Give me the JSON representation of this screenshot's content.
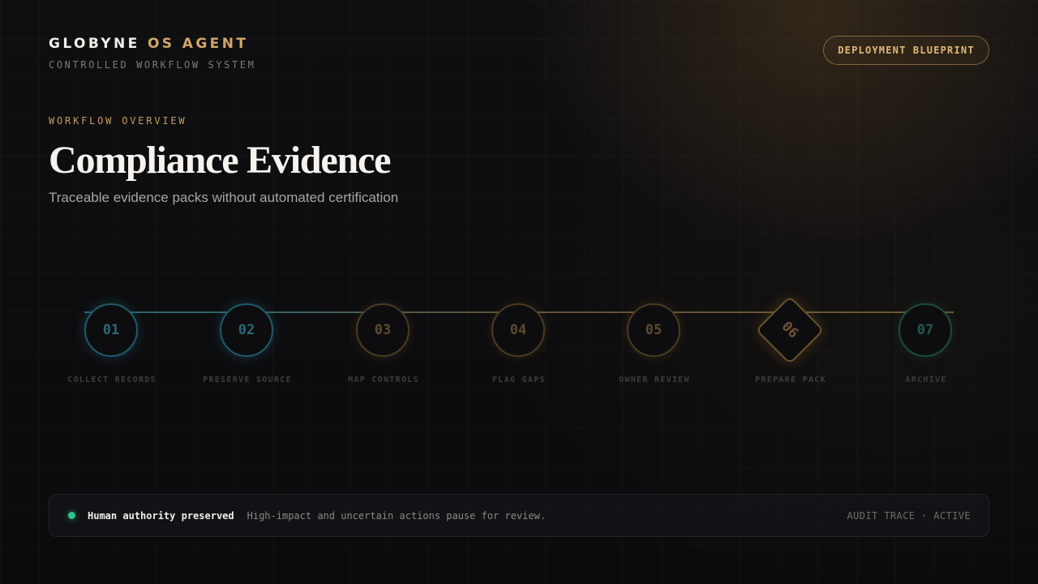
{
  "brand": {
    "title_main": "GLOBYNE",
    "title_accent": "OS AGENT",
    "subtitle": "CONTROLLED WORKFLOW SYSTEM"
  },
  "badge": {
    "label": "DEPLOYMENT BLUEPRINT"
  },
  "hero": {
    "eyebrow": "WORKFLOW OVERVIEW",
    "title": "Compliance Evidence",
    "subtitle": "Traceable evidence packs without automated certification"
  },
  "steps": [
    {
      "num": "01",
      "label": "COLLECT RECORDS",
      "style": "teal"
    },
    {
      "num": "02",
      "label": "PRESERVE SOURCE",
      "style": "teal"
    },
    {
      "num": "03",
      "label": "MAP CONTROLS",
      "style": "gold"
    },
    {
      "num": "04",
      "label": "FLAG GAPS",
      "style": "gold"
    },
    {
      "num": "05",
      "label": "OWNER REVIEW",
      "style": "gold"
    },
    {
      "num": "06",
      "label": "PREPARE PACK",
      "style": "diamond"
    },
    {
      "num": "07",
      "label": "ARCHIVE",
      "style": "green"
    }
  ],
  "footer": {
    "strong": "Human authority preserved",
    "text": "High-impact and uncertain actions pause for review.",
    "status": "AUDIT TRACE · ACTIVE"
  },
  "colors": {
    "accent_gold": "#d3a66a",
    "teal": "#2a6778",
    "status_green": "#2fc58d"
  }
}
